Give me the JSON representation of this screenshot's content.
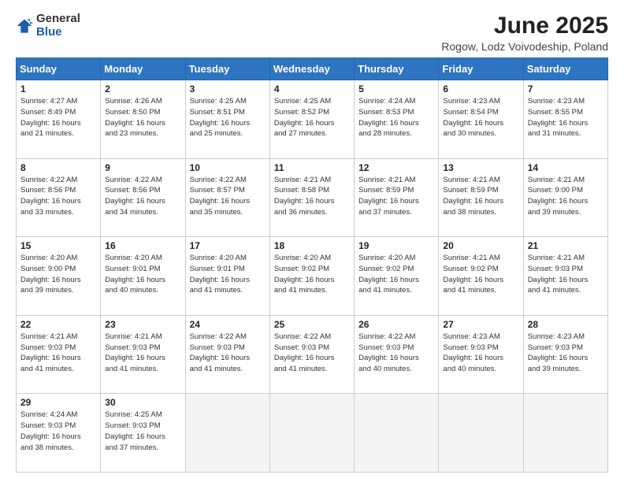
{
  "logo": {
    "general": "General",
    "blue": "Blue"
  },
  "title": "June 2025",
  "subtitle": "Rogow, Lodz Voivodeship, Poland",
  "calendar": {
    "headers": [
      "Sunday",
      "Monday",
      "Tuesday",
      "Wednesday",
      "Thursday",
      "Friday",
      "Saturday"
    ],
    "rows": [
      [
        {
          "day": "1",
          "info": "Sunrise: 4:27 AM\nSunset: 8:49 PM\nDaylight: 16 hours\nand 21 minutes."
        },
        {
          "day": "2",
          "info": "Sunrise: 4:26 AM\nSunset: 8:50 PM\nDaylight: 16 hours\nand 23 minutes."
        },
        {
          "day": "3",
          "info": "Sunrise: 4:25 AM\nSunset: 8:51 PM\nDaylight: 16 hours\nand 25 minutes."
        },
        {
          "day": "4",
          "info": "Sunrise: 4:25 AM\nSunset: 8:52 PM\nDaylight: 16 hours\nand 27 minutes."
        },
        {
          "day": "5",
          "info": "Sunrise: 4:24 AM\nSunset: 8:53 PM\nDaylight: 16 hours\nand 28 minutes."
        },
        {
          "day": "6",
          "info": "Sunrise: 4:23 AM\nSunset: 8:54 PM\nDaylight: 16 hours\nand 30 minutes."
        },
        {
          "day": "7",
          "info": "Sunrise: 4:23 AM\nSunset: 8:55 PM\nDaylight: 16 hours\nand 31 minutes."
        }
      ],
      [
        {
          "day": "8",
          "info": "Sunrise: 4:22 AM\nSunset: 8:56 PM\nDaylight: 16 hours\nand 33 minutes."
        },
        {
          "day": "9",
          "info": "Sunrise: 4:22 AM\nSunset: 8:56 PM\nDaylight: 16 hours\nand 34 minutes."
        },
        {
          "day": "10",
          "info": "Sunrise: 4:22 AM\nSunset: 8:57 PM\nDaylight: 16 hours\nand 35 minutes."
        },
        {
          "day": "11",
          "info": "Sunrise: 4:21 AM\nSunset: 8:58 PM\nDaylight: 16 hours\nand 36 minutes."
        },
        {
          "day": "12",
          "info": "Sunrise: 4:21 AM\nSunset: 8:59 PM\nDaylight: 16 hours\nand 37 minutes."
        },
        {
          "day": "13",
          "info": "Sunrise: 4:21 AM\nSunset: 8:59 PM\nDaylight: 16 hours\nand 38 minutes."
        },
        {
          "day": "14",
          "info": "Sunrise: 4:21 AM\nSunset: 9:00 PM\nDaylight: 16 hours\nand 39 minutes."
        }
      ],
      [
        {
          "day": "15",
          "info": "Sunrise: 4:20 AM\nSunset: 9:00 PM\nDaylight: 16 hours\nand 39 minutes."
        },
        {
          "day": "16",
          "info": "Sunrise: 4:20 AM\nSunset: 9:01 PM\nDaylight: 16 hours\nand 40 minutes."
        },
        {
          "day": "17",
          "info": "Sunrise: 4:20 AM\nSunset: 9:01 PM\nDaylight: 16 hours\nand 41 minutes."
        },
        {
          "day": "18",
          "info": "Sunrise: 4:20 AM\nSunset: 9:02 PM\nDaylight: 16 hours\nand 41 minutes."
        },
        {
          "day": "19",
          "info": "Sunrise: 4:20 AM\nSunset: 9:02 PM\nDaylight: 16 hours\nand 41 minutes."
        },
        {
          "day": "20",
          "info": "Sunrise: 4:21 AM\nSunset: 9:02 PM\nDaylight: 16 hours\nand 41 minutes."
        },
        {
          "day": "21",
          "info": "Sunrise: 4:21 AM\nSunset: 9:03 PM\nDaylight: 16 hours\nand 41 minutes."
        }
      ],
      [
        {
          "day": "22",
          "info": "Sunrise: 4:21 AM\nSunset: 9:03 PM\nDaylight: 16 hours\nand 41 minutes."
        },
        {
          "day": "23",
          "info": "Sunrise: 4:21 AM\nSunset: 9:03 PM\nDaylight: 16 hours\nand 41 minutes."
        },
        {
          "day": "24",
          "info": "Sunrise: 4:22 AM\nSunset: 9:03 PM\nDaylight: 16 hours\nand 41 minutes."
        },
        {
          "day": "25",
          "info": "Sunrise: 4:22 AM\nSunset: 9:03 PM\nDaylight: 16 hours\nand 41 minutes."
        },
        {
          "day": "26",
          "info": "Sunrise: 4:22 AM\nSunset: 9:03 PM\nDaylight: 16 hours\nand 40 minutes."
        },
        {
          "day": "27",
          "info": "Sunrise: 4:23 AM\nSunset: 9:03 PM\nDaylight: 16 hours\nand 40 minutes."
        },
        {
          "day": "28",
          "info": "Sunrise: 4:23 AM\nSunset: 9:03 PM\nDaylight: 16 hours\nand 39 minutes."
        }
      ],
      [
        {
          "day": "29",
          "info": "Sunrise: 4:24 AM\nSunset: 9:03 PM\nDaylight: 16 hours\nand 38 minutes."
        },
        {
          "day": "30",
          "info": "Sunrise: 4:25 AM\nSunset: 9:03 PM\nDaylight: 16 hours\nand 37 minutes."
        },
        {
          "day": "",
          "info": "",
          "empty": true
        },
        {
          "day": "",
          "info": "",
          "empty": true
        },
        {
          "day": "",
          "info": "",
          "empty": true
        },
        {
          "day": "",
          "info": "",
          "empty": true
        },
        {
          "day": "",
          "info": "",
          "empty": true
        }
      ]
    ]
  }
}
